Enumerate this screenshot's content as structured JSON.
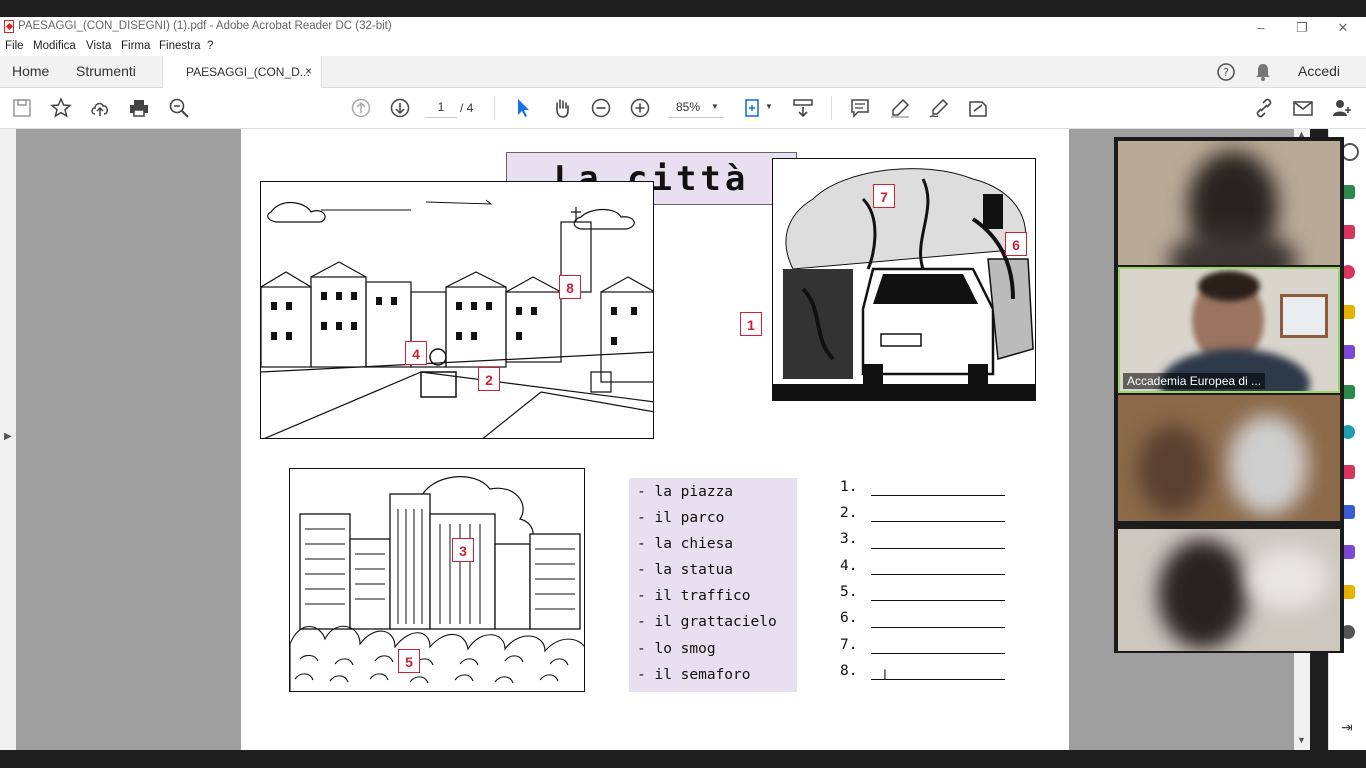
{
  "window": {
    "title": "PAESAGGI_(CON_DISEGNI) (1).pdf - Adobe Acrobat Reader DC (32-bit)"
  },
  "menu": {
    "items": [
      "File",
      "Modifica",
      "Vista",
      "Firma",
      "Finestra",
      "?"
    ]
  },
  "tabs": {
    "home": "Home",
    "tools": "Strumenti",
    "document": "PAESAGGI_(CON_D...",
    "close": "×"
  },
  "account": {
    "signin": "Accedi"
  },
  "toolbar": {
    "current_page": "1",
    "total_pages": "/ 4",
    "zoom": "85%"
  },
  "document": {
    "title": "La città",
    "labels": [
      "1",
      "2",
      "3",
      "4",
      "5",
      "6",
      "7",
      "8"
    ],
    "vocabulary": [
      "- la piazza",
      "- il parco",
      "- la chiesa",
      "- la statua",
      "- il traffico",
      "- il grattacielo",
      "- lo smog",
      "- il semaforo"
    ],
    "answers": [
      "1.",
      "2.",
      "3.",
      "4.",
      "5.",
      "6.",
      "7.",
      "8."
    ]
  },
  "video": {
    "speaker_name": "Accademia Europea di ..."
  },
  "colors": {
    "accent_pink": "#e8dff0",
    "label_red": "#cc2233",
    "active_speaker_border": "#9bd36a"
  }
}
